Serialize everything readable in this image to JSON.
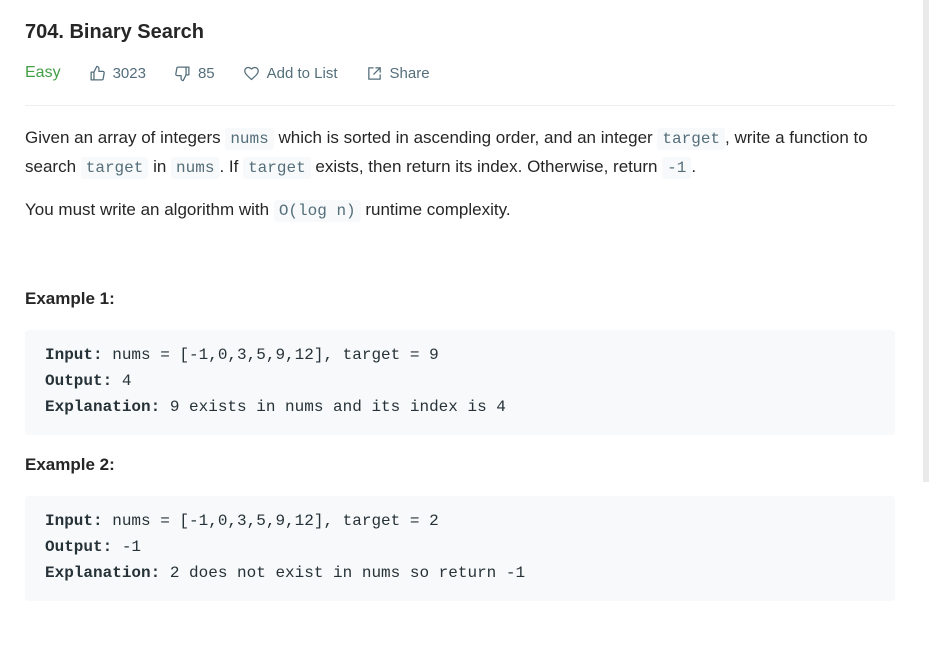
{
  "problem": {
    "title": "704. Binary Search",
    "difficulty": "Easy",
    "likes": "3023",
    "dislikes": "85",
    "add_to_list": "Add to List",
    "share": "Share"
  },
  "description": {
    "p1": {
      "t1": "Given an array of integers ",
      "c1": "nums",
      "t2": " which is sorted in ascending order, and an integer ",
      "c2": "target",
      "t3": ", write a function to search ",
      "c3": "target",
      "t4": " in ",
      "c4": "nums",
      "t5": ". If ",
      "c5": "target",
      "t6": " exists, then return its index. Otherwise, return ",
      "c6": "-1",
      "t7": "."
    },
    "p2": {
      "t1": "You must write an algorithm with ",
      "c1": "O(log n)",
      "t2": " runtime complexity."
    }
  },
  "examples": [
    {
      "heading": "Example 1:",
      "input_label": "Input:",
      "input_value": " nums = [-1,0,3,5,9,12], target = 9",
      "output_label": "Output:",
      "output_value": " 4",
      "explanation_label": "Explanation:",
      "explanation_value": " 9 exists in nums and its index is 4"
    },
    {
      "heading": "Example 2:",
      "input_label": "Input:",
      "input_value": " nums = [-1,0,3,5,9,12], target = 2",
      "output_label": "Output:",
      "output_value": " -1",
      "explanation_label": "Explanation:",
      "explanation_value": " 2 does not exist in nums so return -1"
    }
  ],
  "colors": {
    "easy": "#43a047",
    "meta_text": "#546e7a",
    "code_bg": "#f7f9fa"
  },
  "icons": [
    "thumbs-up-icon",
    "thumbs-down-icon",
    "heart-icon",
    "share-icon"
  ]
}
